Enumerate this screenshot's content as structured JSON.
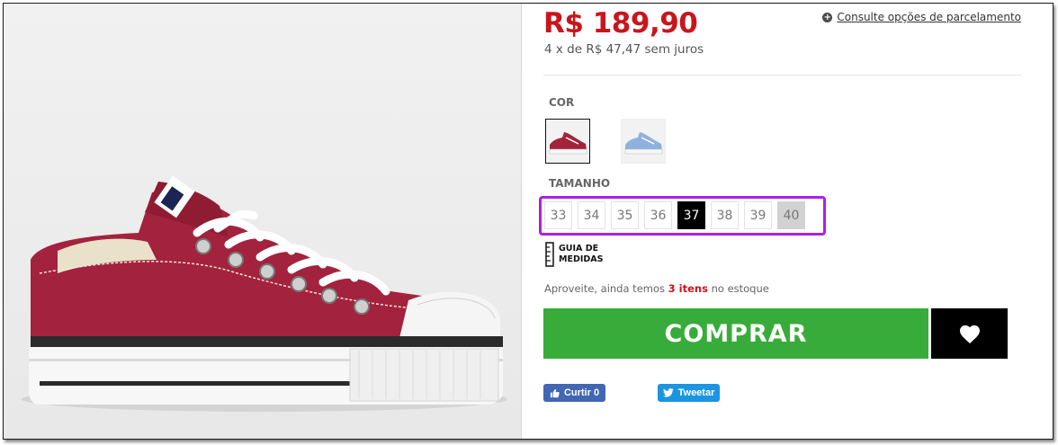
{
  "price": {
    "current": "R$ 189,90",
    "installments": "4 x de R$ 47,47 sem juros",
    "consult_link": "Consulte opções de parcelamento"
  },
  "color": {
    "label": "COR",
    "swatches": [
      {
        "name": "bordô",
        "color": "#a3223d",
        "selected": true
      },
      {
        "name": "azul",
        "color": "#8fb1de",
        "selected": false
      }
    ]
  },
  "size": {
    "label": "TAMANHO",
    "options": [
      "33",
      "34",
      "35",
      "36",
      "37",
      "38",
      "39",
      "40"
    ],
    "selected": "37",
    "unavailable": [
      "40"
    ]
  },
  "size_guide": {
    "label_line1": "GUIA DE",
    "label_line2": "MEDIDAS",
    "icon": "ruler-icon"
  },
  "stock": {
    "prefix": "Aproveite, ainda temos",
    "quantity": "3 itens",
    "suffix": "no estoque"
  },
  "actions": {
    "buy_label": "COMPRAR",
    "wishlist_icon": "heart-icon"
  },
  "social": {
    "facebook_label": "Curtir 0",
    "twitter_label": "Tweetar"
  },
  "colors": {
    "price": "#c8161d",
    "buy_button": "#38ac3a",
    "highlight_box": "#b01ee3",
    "facebook": "#4267b2",
    "twitter": "#1b95e0"
  }
}
